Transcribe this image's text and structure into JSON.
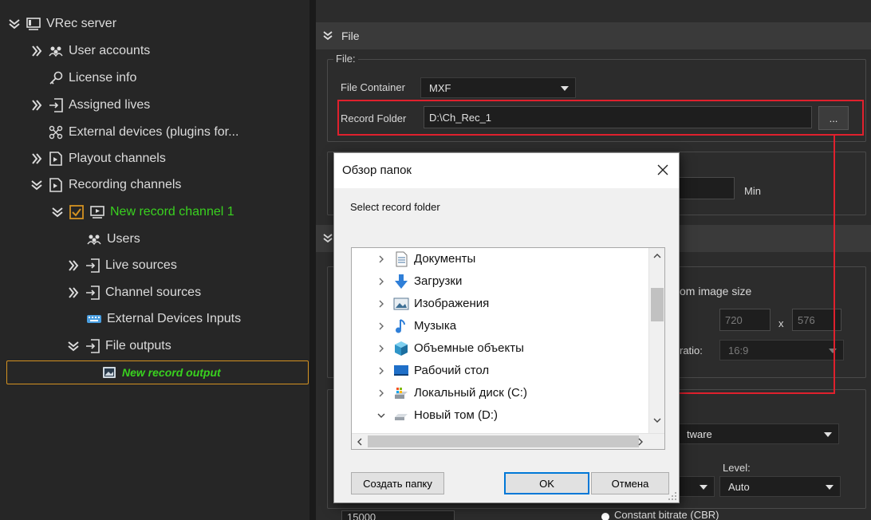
{
  "tree": {
    "items": [
      {
        "label": "VRec server",
        "expanded": true
      },
      {
        "label": "User accounts"
      },
      {
        "label": "License info"
      },
      {
        "label": "Assigned lives"
      },
      {
        "label": "External devices (plugins for..."
      },
      {
        "label": "Playout channels"
      },
      {
        "label": "Recording channels"
      },
      {
        "label": "New record channel 1"
      },
      {
        "label": "Users"
      },
      {
        "label": "Live sources"
      },
      {
        "label": "Channel sources"
      },
      {
        "label": "External Devices Inputs"
      },
      {
        "label": "File outputs"
      },
      {
        "label": "New record output"
      }
    ]
  },
  "panel": {
    "file_section_title": "File",
    "file_group_label": "File:",
    "file_container_label": "File Container",
    "file_container_value": "MXF",
    "record_folder_label": "Record Folder",
    "record_folder_value": "D:\\Ch_Rec_1",
    "browse_label": "...",
    "min_label": "Min",
    "custom_image_size_label": "om image size",
    "width_value": "720",
    "x_label": "x",
    "height_value": "576",
    "ratio_label": "ratio:",
    "ratio_value": "16:9",
    "encoder_value": "tware",
    "level_label": "Level:",
    "level_value": "Auto",
    "bitrate_value": "15000",
    "bitrate_mode_label": "Constant bitrate (CBR)"
  },
  "dialog": {
    "title": "Обзор папок",
    "description": "Select record folder",
    "folders": [
      {
        "label": "Документы",
        "icon": "documents-icon"
      },
      {
        "label": "Загрузки",
        "icon": "downloads-icon"
      },
      {
        "label": "Изображения",
        "icon": "pictures-icon"
      },
      {
        "label": "Музыка",
        "icon": "music-icon"
      },
      {
        "label": "Объемные объекты",
        "icon": "3d-objects-icon"
      },
      {
        "label": "Рабочий стол",
        "icon": "desktop-icon"
      },
      {
        "label": "Локальный диск (C:)",
        "icon": "local-disk-icon"
      },
      {
        "label": "Новый том (D:)",
        "icon": "drive-icon"
      }
    ],
    "new_folder_label": "Создать папку",
    "ok_label": "OK",
    "cancel_label": "Отмена"
  },
  "colors": {
    "accent_green": "#39d11f",
    "selection_orange": "#d49221",
    "annotation_red": "#e0202d",
    "dialog_focus_blue": "#0078d7"
  }
}
